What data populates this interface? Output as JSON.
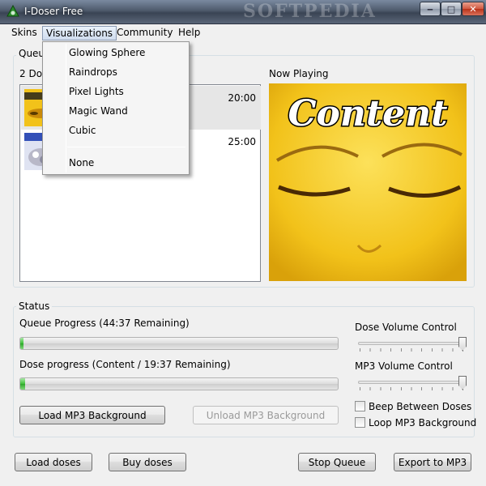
{
  "window": {
    "title": "I-Doser Free",
    "watermark": "SOFTPEDIA",
    "min_glyph": "‒",
    "max_glyph": "□",
    "close_glyph": "✕"
  },
  "menu": {
    "items": [
      "Skins",
      "Visualizations",
      "Community",
      "Help"
    ]
  },
  "visualizations_menu": {
    "items": [
      "Glowing Sphere",
      "Raindrops",
      "Pixel Lights",
      "Magic Wand",
      "Cubic"
    ],
    "none_label": "None"
  },
  "queue": {
    "group_label": "Queue",
    "count_label": "2 Doses",
    "doses": [
      {
        "time": "20:00",
        "selected": true
      },
      {
        "time": "25:00",
        "selected": false
      }
    ]
  },
  "now_playing": {
    "label": "Now Playing",
    "image_text": "Content"
  },
  "status": {
    "group_label": "Status",
    "queue_progress_label": "Queue Progress (44:37 Remaining)",
    "queue_progress_fraction": 0.01,
    "dose_progress_label": "Dose progress (Content / 19:37 Remaining)",
    "dose_progress_fraction": 0.015,
    "dose_volume_label": "Dose Volume Control",
    "dose_volume_fraction": 1.0,
    "mp3_volume_label": "MP3 Volume Control",
    "mp3_volume_fraction": 1.0,
    "beep_label": "Beep Between Doses",
    "beep_checked": false,
    "loop_label": "Loop MP3 Background",
    "loop_checked": false,
    "load_mp3_label": "Load MP3 Background",
    "unload_mp3_label": "Unload MP3 Background"
  },
  "footer": {
    "load_doses": "Load doses",
    "buy_doses": "Buy doses",
    "stop_queue": "Stop Queue",
    "export_mp3": "Export to MP3"
  },
  "colors": {
    "progress_green": "#3fbf3a",
    "now_playing_yellow": "#f2c21a"
  }
}
